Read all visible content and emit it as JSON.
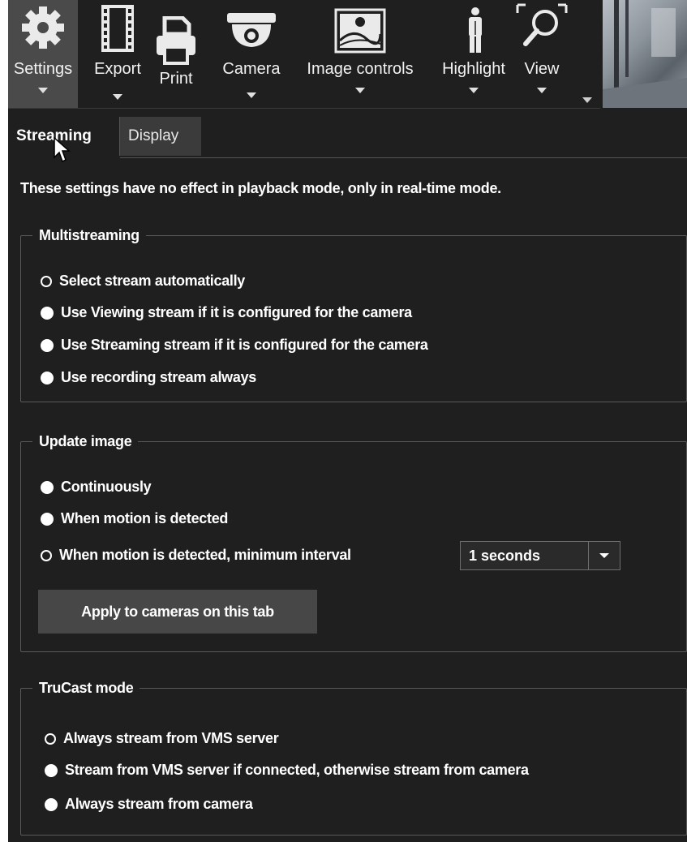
{
  "toolbar": {
    "items": [
      {
        "label": "Settings",
        "icon": "gear-icon",
        "active": true
      },
      {
        "label": "Export",
        "icon": "film-icon"
      },
      {
        "label": "Print",
        "icon": "printer-icon"
      },
      {
        "label": "Camera",
        "icon": "dome-camera-icon"
      },
      {
        "label": "Image controls",
        "icon": "image-icon"
      },
      {
        "label": "Highlight",
        "icon": "person-icon"
      },
      {
        "label": "View",
        "icon": "magnifier-icon"
      }
    ]
  },
  "tabs": [
    {
      "label": "Streaming",
      "active": true
    },
    {
      "label": "Display",
      "active": false
    }
  ],
  "notice": "These settings have no effect in playback mode, only in real-time mode.",
  "multistreaming": {
    "title": "Multistreaming",
    "options": [
      {
        "label": "Select stream automatically",
        "checked": true
      },
      {
        "label": "Use Viewing stream if it is configured for the camera",
        "checked": false
      },
      {
        "label": "Use Streaming stream if it is configured for the camera",
        "checked": false
      },
      {
        "label": "Use recording stream always",
        "checked": false
      }
    ]
  },
  "update_image": {
    "title": "Update image",
    "options": [
      {
        "label": "Continuously",
        "checked": false
      },
      {
        "label": "When motion is detected",
        "checked": false
      },
      {
        "label": "When motion is detected, minimum interval",
        "checked": true
      }
    ],
    "interval_value": "1 seconds",
    "apply_label": "Apply to cameras on this tab"
  },
  "trucast": {
    "title": "TruCast mode",
    "options": [
      {
        "label": "Always stream from VMS server",
        "checked": true
      },
      {
        "label": "Stream from VMS server if connected, otherwise stream from camera",
        "checked": false
      },
      {
        "label": "Always stream from camera",
        "checked": false
      }
    ]
  },
  "colors": {
    "panel_bg": "#1f1f1f",
    "active_toolbar_bg": "#4a4a4a",
    "button_bg": "#474747",
    "text": "#ffffff"
  }
}
